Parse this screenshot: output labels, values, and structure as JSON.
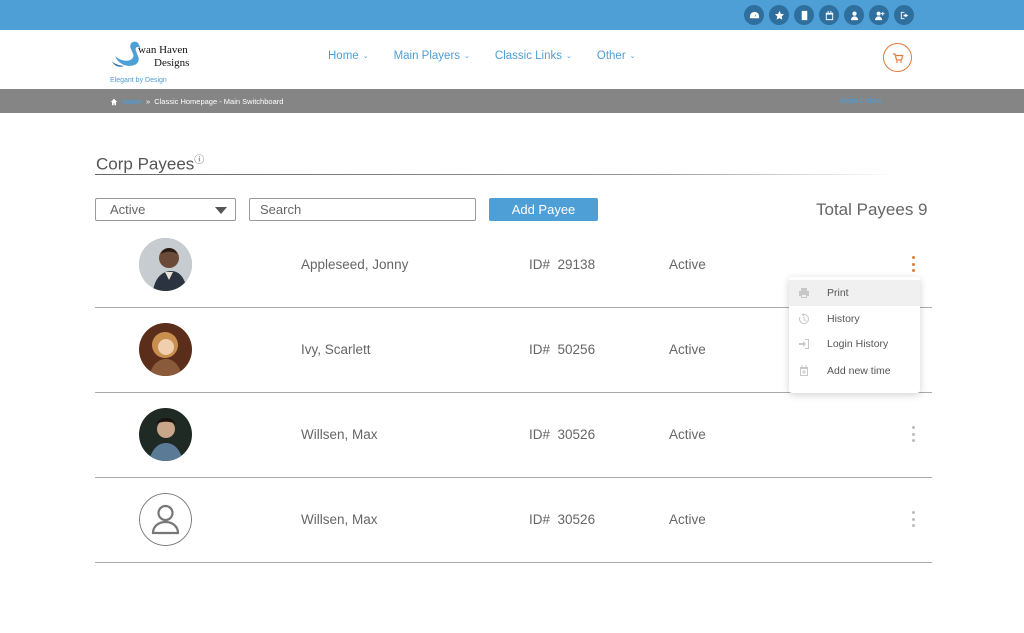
{
  "topbar": {
    "icons": [
      "dashboard-icon",
      "star-icon",
      "document-icon",
      "calendar-icon",
      "user-icon",
      "add-user-icon",
      "logout-icon"
    ]
  },
  "header": {
    "logo": {
      "line1": "wan Haven",
      "line2": "Designs",
      "tagline": "Elegant by Design"
    },
    "nav": [
      {
        "label": "Home"
      },
      {
        "label": "Main Players"
      },
      {
        "label": "Classic Links"
      },
      {
        "label": "Other"
      }
    ],
    "cart_icon": "cart-icon"
  },
  "breadcrumb": {
    "home": "Home",
    "separator": "»",
    "current": "Classic Homepage - Main Switchboard",
    "right_link": "Mona Clobos"
  },
  "page": {
    "title": "Corp Payees",
    "info_mark": "ⓘ",
    "filter_value": "Active",
    "search_placeholder": "Search",
    "add_button": "Add Payee",
    "total_label": "Total Payees 9"
  },
  "payees": [
    {
      "name": "Appleseed, Jonny",
      "id_label": "ID#",
      "id": "29138",
      "status": "Active",
      "avatar": "photo",
      "menu_open": true
    },
    {
      "name": "Ivy, Scarlett",
      "id_label": "ID#",
      "id": "50256",
      "status": "Active",
      "avatar": "photo",
      "menu_open": false
    },
    {
      "name": "Willsen, Max",
      "id_label": "ID#",
      "id": "30526",
      "status": "Active",
      "avatar": "photo",
      "menu_open": false
    },
    {
      "name": "Willsen, Max",
      "id_label": "ID#",
      "id": "30526",
      "status": "Active",
      "avatar": "placeholder",
      "menu_open": false
    }
  ],
  "row_menu": {
    "items": [
      {
        "label": "Print",
        "icon": "print-icon"
      },
      {
        "label": "History",
        "icon": "history-icon"
      },
      {
        "label": "Login History",
        "icon": "login-icon"
      },
      {
        "label": "Add new time",
        "icon": "calendar-add-icon"
      }
    ]
  },
  "colors": {
    "accent": "#4e9fd6",
    "orange": "#e07b3d",
    "breadcrumb_bg": "#858585"
  }
}
